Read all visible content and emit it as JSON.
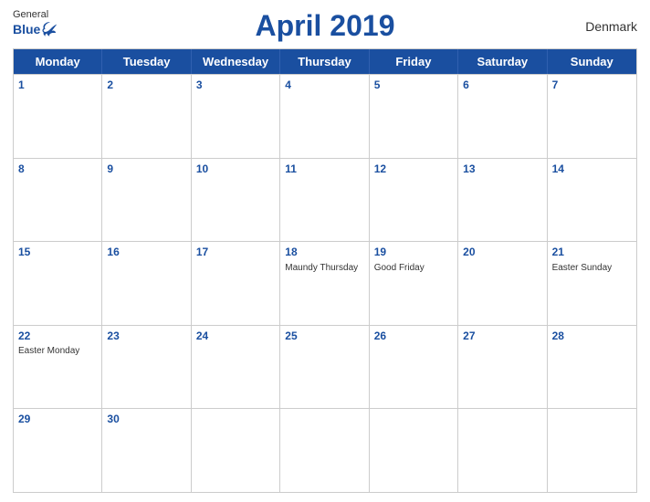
{
  "header": {
    "title": "April 2019",
    "country": "Denmark",
    "logo": {
      "general": "General",
      "blue": "Blue"
    }
  },
  "calendar": {
    "weekdays": [
      "Monday",
      "Tuesday",
      "Wednesday",
      "Thursday",
      "Friday",
      "Saturday",
      "Sunday"
    ],
    "weeks": [
      [
        {
          "date": "1",
          "event": ""
        },
        {
          "date": "2",
          "event": ""
        },
        {
          "date": "3",
          "event": ""
        },
        {
          "date": "4",
          "event": ""
        },
        {
          "date": "5",
          "event": ""
        },
        {
          "date": "6",
          "event": ""
        },
        {
          "date": "7",
          "event": ""
        }
      ],
      [
        {
          "date": "8",
          "event": ""
        },
        {
          "date": "9",
          "event": ""
        },
        {
          "date": "10",
          "event": ""
        },
        {
          "date": "11",
          "event": ""
        },
        {
          "date": "12",
          "event": ""
        },
        {
          "date": "13",
          "event": ""
        },
        {
          "date": "14",
          "event": ""
        }
      ],
      [
        {
          "date": "15",
          "event": ""
        },
        {
          "date": "16",
          "event": ""
        },
        {
          "date": "17",
          "event": ""
        },
        {
          "date": "18",
          "event": "Maundy Thursday"
        },
        {
          "date": "19",
          "event": "Good Friday"
        },
        {
          "date": "20",
          "event": ""
        },
        {
          "date": "21",
          "event": "Easter Sunday"
        }
      ],
      [
        {
          "date": "22",
          "event": "Easter Monday"
        },
        {
          "date": "23",
          "event": ""
        },
        {
          "date": "24",
          "event": ""
        },
        {
          "date": "25",
          "event": ""
        },
        {
          "date": "26",
          "event": ""
        },
        {
          "date": "27",
          "event": ""
        },
        {
          "date": "28",
          "event": ""
        }
      ],
      [
        {
          "date": "29",
          "event": ""
        },
        {
          "date": "30",
          "event": ""
        },
        {
          "date": "",
          "event": ""
        },
        {
          "date": "",
          "event": ""
        },
        {
          "date": "",
          "event": ""
        },
        {
          "date": "",
          "event": ""
        },
        {
          "date": "",
          "event": ""
        }
      ]
    ]
  }
}
